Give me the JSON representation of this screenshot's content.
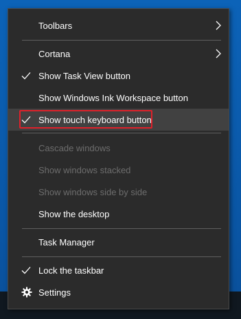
{
  "menu": {
    "items": [
      {
        "label": "Toolbars",
        "checked": false,
        "disabled": false,
        "submenu": true,
        "icon": "chevron-right-icon"
      },
      {
        "label": "Cortana",
        "checked": false,
        "disabled": false,
        "submenu": true,
        "icon": "chevron-right-icon"
      },
      {
        "label": "Show Task View button",
        "checked": true,
        "disabled": false
      },
      {
        "label": "Show Windows Ink Workspace button",
        "checked": false,
        "disabled": false
      },
      {
        "label": "Show touch keyboard button",
        "checked": true,
        "disabled": false,
        "hovered": true,
        "highlighted": true
      },
      {
        "label": "Cascade windows",
        "checked": false,
        "disabled": true
      },
      {
        "label": "Show windows stacked",
        "checked": false,
        "disabled": true
      },
      {
        "label": "Show windows side by side",
        "checked": false,
        "disabled": true
      },
      {
        "label": "Show the desktop",
        "checked": false,
        "disabled": false
      },
      {
        "label": "Task Manager",
        "checked": false,
        "disabled": false
      },
      {
        "label": "Lock the taskbar",
        "checked": true,
        "disabled": false
      },
      {
        "label": "Settings",
        "checked": false,
        "disabled": false,
        "icon": "gear-icon"
      }
    ]
  },
  "colors": {
    "menu_background": "#2b2b2b",
    "hover_background": "#414141",
    "highlight_border": "#e0202a",
    "disabled_text": "#6d6d6d",
    "desktop": "#0a5aa9"
  }
}
